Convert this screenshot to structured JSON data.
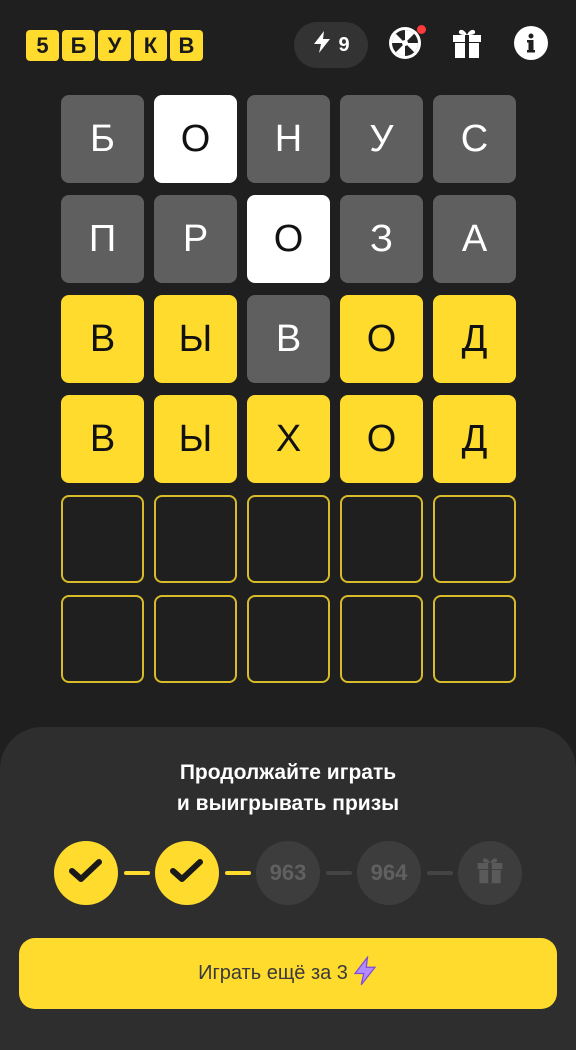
{
  "header": {
    "logo_letters": [
      "5",
      "Б",
      "У",
      "К",
      "В"
    ],
    "energy_count": "9"
  },
  "grid": {
    "rows": [
      [
        {
          "l": "Б",
          "s": "gray"
        },
        {
          "l": "О",
          "s": "white"
        },
        {
          "l": "Н",
          "s": "gray"
        },
        {
          "l": "У",
          "s": "gray"
        },
        {
          "l": "С",
          "s": "gray"
        }
      ],
      [
        {
          "l": "П",
          "s": "gray"
        },
        {
          "l": "Р",
          "s": "gray"
        },
        {
          "l": "О",
          "s": "white"
        },
        {
          "l": "З",
          "s": "gray"
        },
        {
          "l": "А",
          "s": "gray"
        }
      ],
      [
        {
          "l": "В",
          "s": "yellow"
        },
        {
          "l": "Ы",
          "s": "yellow"
        },
        {
          "l": "В",
          "s": "gray"
        },
        {
          "l": "О",
          "s": "yellow"
        },
        {
          "l": "Д",
          "s": "yellow"
        }
      ],
      [
        {
          "l": "В",
          "s": "yellow"
        },
        {
          "l": "Ы",
          "s": "yellow"
        },
        {
          "l": "Х",
          "s": "yellow"
        },
        {
          "l": "О",
          "s": "yellow"
        },
        {
          "l": "Д",
          "s": "yellow"
        }
      ],
      [
        {
          "l": "",
          "s": "empty"
        },
        {
          "l": "",
          "s": "empty"
        },
        {
          "l": "",
          "s": "empty"
        },
        {
          "l": "",
          "s": "empty"
        },
        {
          "l": "",
          "s": "empty"
        }
      ],
      [
        {
          "l": "",
          "s": "empty"
        },
        {
          "l": "",
          "s": "empty"
        },
        {
          "l": "",
          "s": "empty"
        },
        {
          "l": "",
          "s": "empty"
        },
        {
          "l": "",
          "s": "empty"
        }
      ]
    ]
  },
  "panel": {
    "title_line1": "Продолжайте играть",
    "title_line2": "и выигрывать призы",
    "steps": [
      {
        "state": "done",
        "label": ""
      },
      {
        "state": "done",
        "label": ""
      },
      {
        "state": "pending",
        "label": "963"
      },
      {
        "state": "pending",
        "label": "964"
      },
      {
        "state": "gift",
        "label": ""
      }
    ],
    "cta_label": "Играть ещё за 3"
  },
  "colors": {
    "accent": "#fedb2c",
    "background": "#1f1f1f",
    "panel": "#2e2e2e",
    "gray_tile": "#5f5f5f",
    "notification": "#ff3b3b"
  },
  "icons": {
    "energy": "lightning-icon",
    "wheel": "fortune-wheel-icon",
    "gift": "gift-icon",
    "info": "info-icon",
    "check": "checkmark-icon"
  }
}
